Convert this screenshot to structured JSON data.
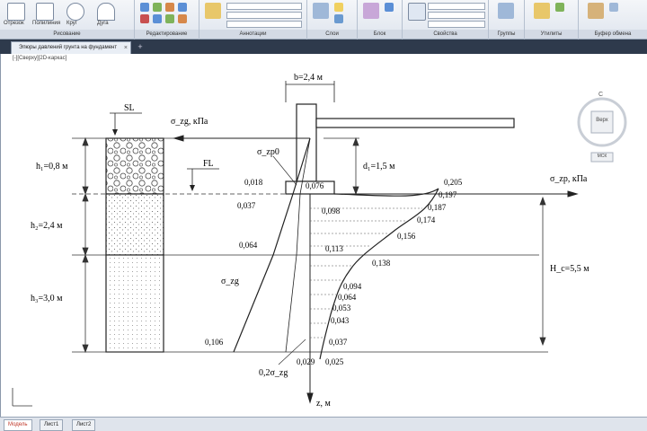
{
  "ribbon": {
    "groups": [
      {
        "id": "draw",
        "label": "Рисование",
        "items": [
          "Отрезок",
          "Полилиния",
          "Круг",
          "Дуга"
        ]
      },
      {
        "id": "modify",
        "label": "Редактирование"
      },
      {
        "id": "annotation",
        "label": "Аннотации"
      },
      {
        "id": "layers",
        "label": "Слои"
      },
      {
        "id": "block",
        "label": "Блок"
      },
      {
        "id": "properties",
        "label": "Свойства"
      },
      {
        "id": "groups",
        "label": "Группы"
      },
      {
        "id": "utilities",
        "label": "Утилиты"
      },
      {
        "id": "clipboard",
        "label": "Буфер обмена"
      }
    ]
  },
  "tab": {
    "title": "Эпюры давлений грунта на фундамент",
    "close": "×",
    "add": "+"
  },
  "viewport_label": "[-][Сверху][2D-каркас]",
  "viewcube": {
    "top": "С",
    "center": "Верх",
    "wcs": "МСК"
  },
  "status": {
    "tabs": [
      "Модель",
      "Лист1",
      "Лист2"
    ],
    "active": 0
  },
  "drawing": {
    "top_dim": "b=2,4 м",
    "sl_mark": "SL",
    "fl_mark": "FL",
    "load_top": "σ_zg, кПа",
    "load_right": "σ_zp, кПа",
    "sigma_zp0": "σ_zp0",
    "sigma_zg": "σ_zg",
    "point_02": "0,2σ_zg",
    "z_axis": "z, м",
    "layer_h1": "h₁=0,8 м",
    "layer_h2": "h₂=2,4 м",
    "layer_h3": "h₃=3,0 м",
    "d_label": "d₁=1,5 м",
    "hc_label": "H_с=5,5 м",
    "zg_values": [
      "0,018",
      "0,037",
      "0,064",
      "0,106"
    ],
    "zp_near": [
      "0,076",
      "0,098",
      "0,113",
      "0,094",
      "0,064",
      "0,053",
      "0,043",
      "0,037",
      "0,029",
      "0,025"
    ],
    "zp_curve": [
      "0,205",
      "0,197",
      "0,187",
      "0,174",
      "0,156",
      "0,138"
    ],
    "zp_at_lines": [
      "0,029",
      "0,025"
    ]
  }
}
